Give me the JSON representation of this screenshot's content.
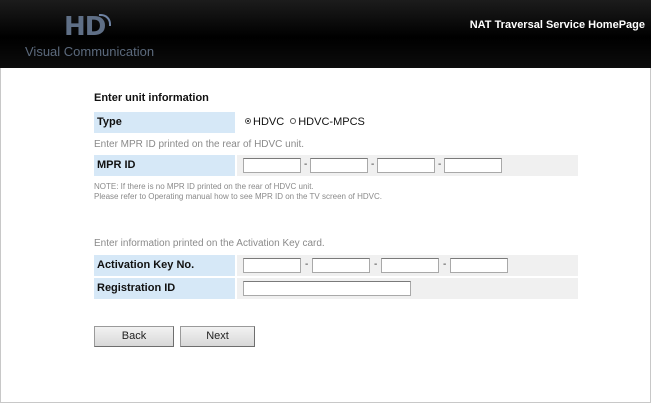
{
  "header": {
    "logo_mark": "HD",
    "logo_text": "Visual Communication",
    "link": "NAT Traversal Service HomePage"
  },
  "form": {
    "section_title": "Enter unit information",
    "type": {
      "label": "Type",
      "options": [
        "HDVC",
        "HDVC-MPCS"
      ],
      "selected": "HDVC"
    },
    "mpr_hint": "Enter MPR ID printed on the rear of HDVC unit.",
    "mpr": {
      "label": "MPR ID",
      "values": [
        "",
        "",
        "",
        ""
      ],
      "separator": "-"
    },
    "note_line1": "NOTE:  If there is no MPR ID printed on the rear of HDVC unit.",
    "note_line2": "Please refer to Operating manual how to see MPR ID on the TV screen of HDVC.",
    "activation_hint": "Enter information printed on the Activation Key card.",
    "activation": {
      "label": "Activation Key No.",
      "values": [
        "",
        "",
        "",
        ""
      ],
      "separator": "-"
    },
    "registration": {
      "label": "Registration ID",
      "value": ""
    }
  },
  "buttons": {
    "back": "Back",
    "next": "Next"
  }
}
